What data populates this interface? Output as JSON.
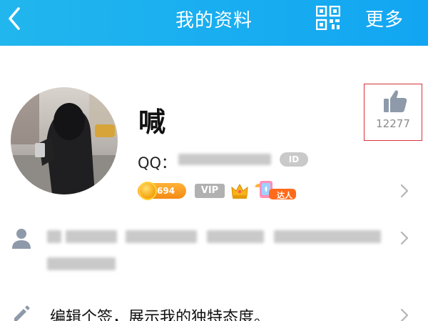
{
  "header": {
    "title": "我的资料",
    "more_label": "更多",
    "background": "#19aef0"
  },
  "profile": {
    "nickname": "喊",
    "qq_label": "QQ：",
    "id_badge": "ID",
    "coin_level": "694",
    "vip_label": "VIP",
    "daren_label": "达人"
  },
  "like": {
    "count": "12277",
    "icon_color": "#8e9aaa",
    "highlight_border": "#d8323a"
  },
  "signature": {
    "placeholder": "编辑个签，展示我的独特态度。"
  },
  "icons": {
    "back": "chevron-left-icon",
    "qr": "qr-code-icon",
    "like": "thumbs-up-icon",
    "person": "person-icon",
    "edit": "pencil-icon",
    "chevron": "chevron-right-icon"
  }
}
